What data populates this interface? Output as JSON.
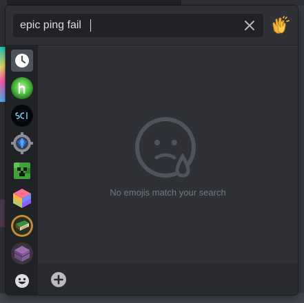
{
  "search": {
    "value": "epic ping fail",
    "clear_icon": "close-icon"
  },
  "skin_tone_icon": "clapping-hands-icon",
  "sidebar": {
    "items": [
      {
        "name": "recent",
        "icon": "clock-icon"
      },
      {
        "name": "server-1",
        "icon": "green-h-icon"
      },
      {
        "name": "server-2",
        "icon": "sci-icon"
      },
      {
        "name": "server-3",
        "icon": "gear-gem-icon"
      },
      {
        "name": "server-4",
        "icon": "creeper-icon"
      },
      {
        "name": "server-5",
        "icon": "rainbow-cube-icon"
      },
      {
        "name": "server-6",
        "icon": "book-icon"
      },
      {
        "name": "server-7",
        "icon": "purple-chest-icon"
      },
      {
        "name": "people",
        "icon": "smiley-icon"
      }
    ]
  },
  "empty": {
    "message": "No emojis match your search",
    "icon": "sad-face-icon"
  },
  "footer": {
    "add_icon": "plus-icon"
  },
  "colors": {
    "panel": "#2f3136",
    "dark": "#202225",
    "muted": "#72767d",
    "text": "#dcddde"
  }
}
